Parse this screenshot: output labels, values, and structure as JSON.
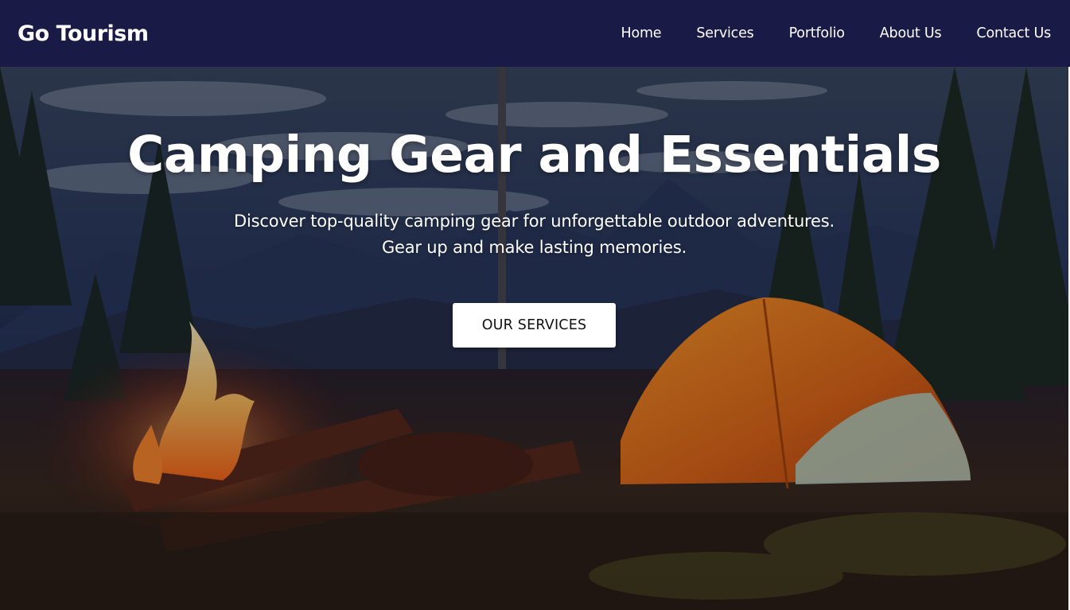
{
  "nav": {
    "brand": "Go Tourism",
    "links": [
      {
        "label": "Home"
      },
      {
        "label": "Services"
      },
      {
        "label": "Portfolio"
      },
      {
        "label": "About Us"
      },
      {
        "label": "Contact Us"
      }
    ]
  },
  "hero": {
    "title": "Camping Gear and Essentials",
    "subtitle_line1": "Discover top-quality camping gear for unforgettable outdoor adventures.",
    "subtitle_line2": "Gear up and make lasting memories.",
    "cta_label": "OUR SERVICES",
    "background_icon": "campsite-scene-image"
  },
  "colors": {
    "navbar": "#1a1a46",
    "text": "#ffffff",
    "button_bg": "#ffffff",
    "button_text": "#111111"
  }
}
